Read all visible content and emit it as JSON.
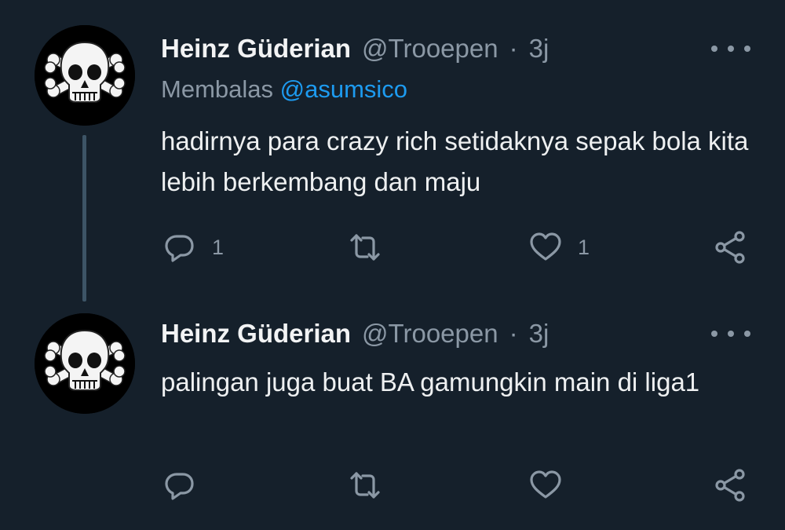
{
  "colors": {
    "background": "#15202b",
    "text": "#e7e9ea",
    "secondary": "#8b98a5",
    "link": "#1d9bf0"
  },
  "tweets": [
    {
      "author_name": "Heinz Güderian",
      "handle": "@Trooepen",
      "separator": "·",
      "time": "3j",
      "reply_prefix": "Membalas",
      "reply_mention": "@asumsico",
      "text": "hadirnya para crazy rich setidaknya sepak bola kita lebih berkembang dan maju",
      "avatar_icon": "skull-crossbones-icon",
      "reply_count": "1",
      "retweet_count": "",
      "like_count": "1"
    },
    {
      "author_name": "Heinz Güderian",
      "handle": "@Trooepen",
      "separator": "·",
      "time": "3j",
      "text": "palingan juga buat BA gamungkin main di liga1",
      "avatar_icon": "skull-crossbones-icon",
      "reply_count": "",
      "retweet_count": "",
      "like_count": ""
    }
  ]
}
